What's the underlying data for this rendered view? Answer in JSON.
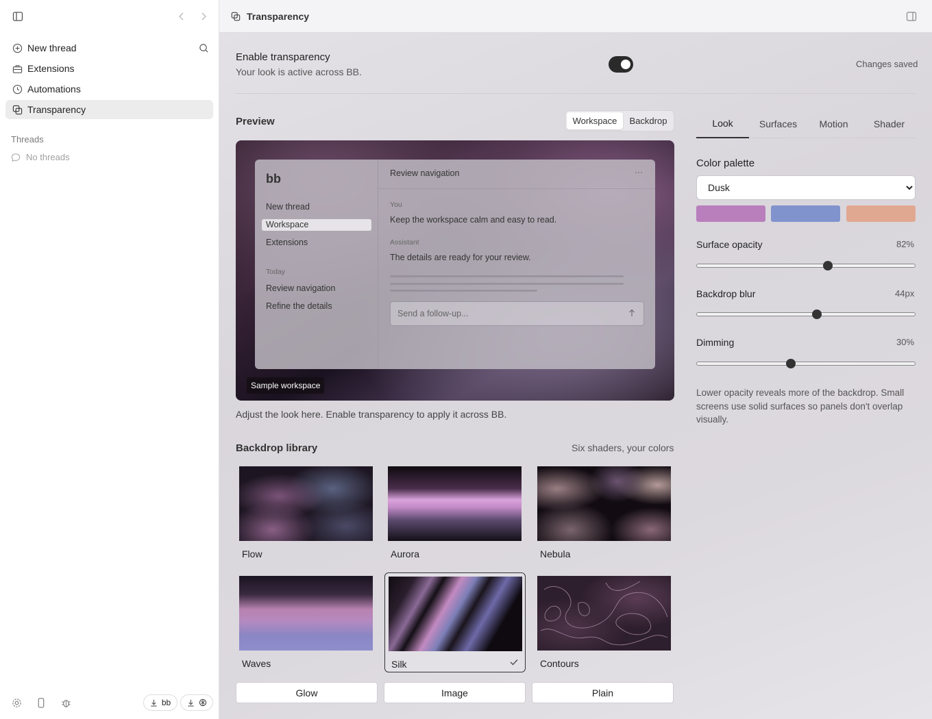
{
  "sidebar": {
    "nav": [
      {
        "label": "New thread",
        "icon": "plus-circle-icon"
      },
      {
        "label": "Extensions",
        "icon": "toolbox-icon"
      },
      {
        "label": "Automations",
        "icon": "clock-icon"
      },
      {
        "label": "Transparency",
        "icon": "layers-icon"
      }
    ],
    "threads_label": "Threads",
    "no_threads": "No threads",
    "footer": {
      "download_bb": "bb"
    }
  },
  "header": {
    "title": "Transparency"
  },
  "enable": {
    "title": "Enable transparency",
    "subtitle": "Your look is active across BB.",
    "toggle_on": true,
    "status": "Changes saved"
  },
  "preview": {
    "title": "Preview",
    "segments": [
      "Workspace",
      "Backdrop"
    ],
    "selected_segment": "Workspace",
    "mock": {
      "logo": "bb",
      "nav": [
        "New thread",
        "Workspace",
        "Extensions"
      ],
      "today_label": "Today",
      "recent": [
        "Review navigation",
        "Refine the details"
      ],
      "thread_title": "Review navigation",
      "menu_glyph": "···",
      "you_label": "You",
      "you_msg": "Keep the workspace calm and easy to read.",
      "assistant_label": "Assistant",
      "assistant_msg": "The details are ready for your review.",
      "input_placeholder": "Send a follow-up..."
    },
    "badge": "Sample workspace",
    "note": "Adjust the look here. Enable transparency to apply it across BB."
  },
  "library": {
    "title": "Backdrop library",
    "subtitle": "Six shaders, your colors",
    "items": [
      {
        "label": "Flow"
      },
      {
        "label": "Aurora"
      },
      {
        "label": "Nebula"
      },
      {
        "label": "Waves"
      },
      {
        "label": "Silk",
        "selected": true
      },
      {
        "label": "Contours"
      }
    ],
    "modes": [
      "Glow",
      "Image",
      "Plain"
    ]
  },
  "settings": {
    "tabs": [
      "Look",
      "Surfaces",
      "Motion",
      "Shader"
    ],
    "active_tab": "Look",
    "palette_label": "Color palette",
    "palette_value": "Dusk",
    "swatches": [
      "#b97fbd",
      "#8193cd",
      "#e1a891"
    ],
    "opacity": {
      "label": "Surface opacity",
      "value": "82%",
      "level": 0.6
    },
    "blur": {
      "label": "Backdrop blur",
      "value": "44px",
      "level": 0.55
    },
    "dimming": {
      "label": "Dimming",
      "value": "30%",
      "level": 0.43
    },
    "help": "Lower opacity reveals more of the backdrop. Small screens use solid surfaces so panels don't overlap visually."
  }
}
